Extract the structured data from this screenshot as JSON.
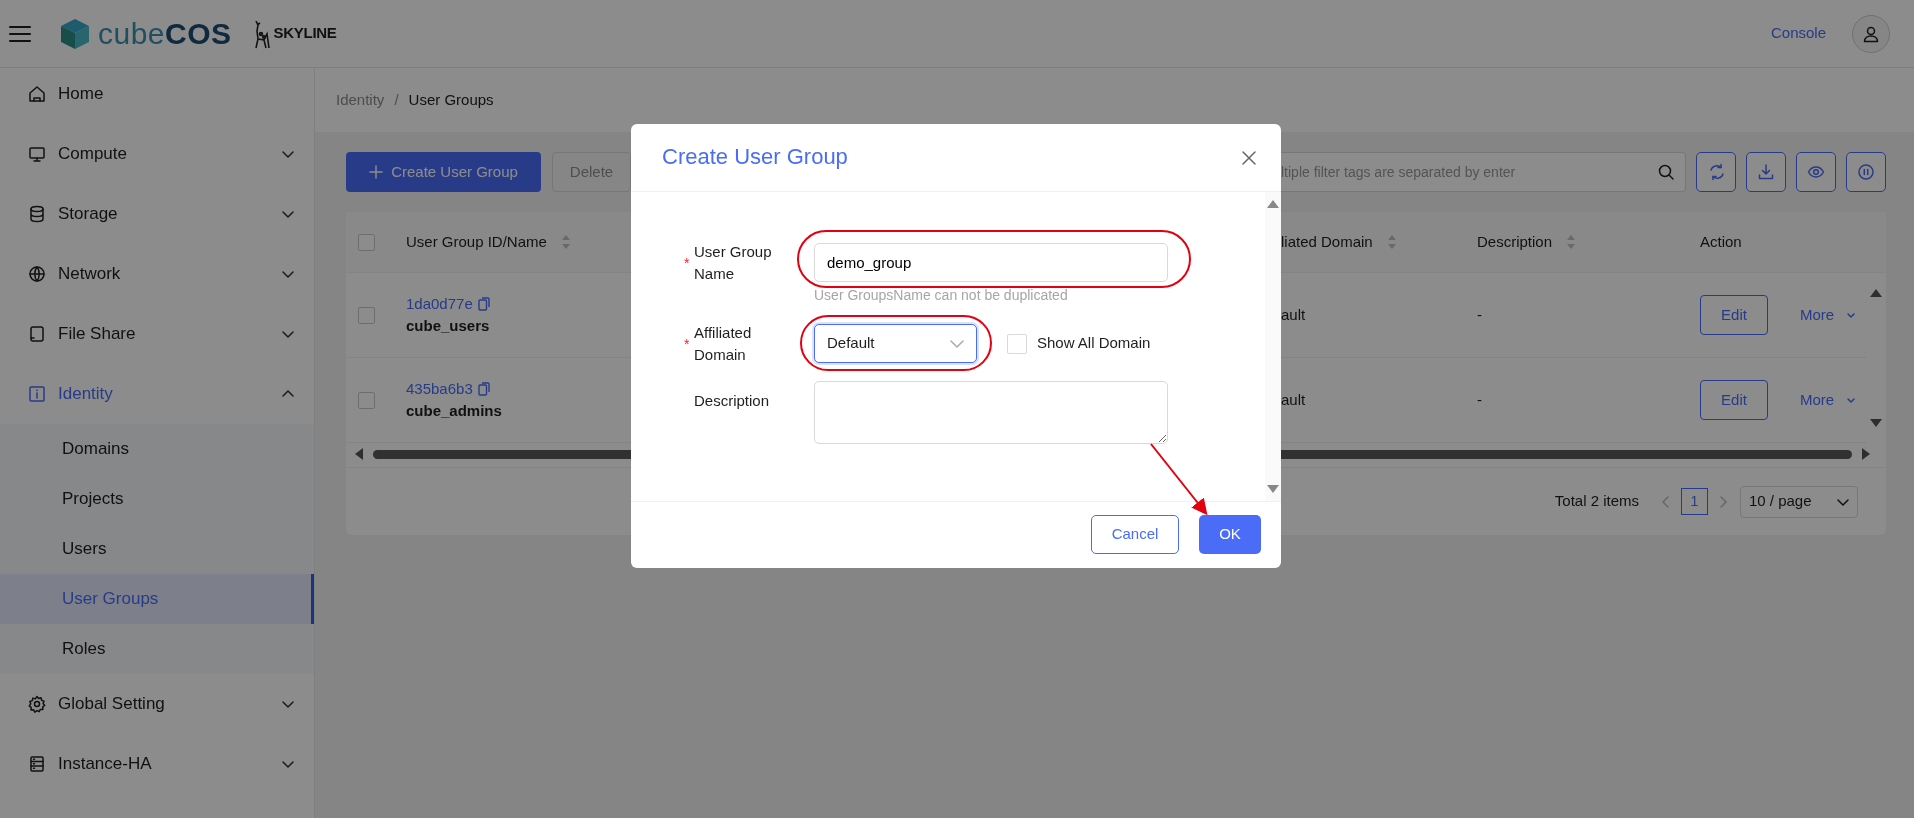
{
  "header": {
    "brand": "cube**COS**",
    "partner": "SKYLINE",
    "console_link": "Console"
  },
  "sidebar": {
    "items": [
      {
        "label": "Home"
      },
      {
        "label": "Compute",
        "expanded": false
      },
      {
        "label": "Storage",
        "expanded": false
      },
      {
        "label": "Network",
        "expanded": false
      },
      {
        "label": "File Share",
        "expanded": false
      },
      {
        "label": "Identity",
        "expanded": true,
        "selected": true,
        "children": [
          {
            "label": "Domains",
            "selected": false
          },
          {
            "label": "Projects",
            "selected": false
          },
          {
            "label": "Users",
            "selected": false
          },
          {
            "label": "User Groups",
            "selected": true
          },
          {
            "label": "Roles",
            "selected": false
          }
        ]
      },
      {
        "label": "Global Setting",
        "expanded": false
      },
      {
        "label": "Instance-HA",
        "expanded": false
      }
    ]
  },
  "breadcrumb": {
    "items": [
      "Identity",
      "User Groups"
    ],
    "separator": "/"
  },
  "toolbar": {
    "create_button": "Create User Group",
    "delete_button": "Delete",
    "delete_disabled": true,
    "search": {
      "placeholder": "ltiple filter tags are separated by enter"
    }
  },
  "table": {
    "all_checked": false,
    "columns": [
      {
        "label": "User Group ID/Name",
        "sortable": true
      },
      {
        "label": "liated Domain",
        "sortable": true
      },
      {
        "label": "Description",
        "sortable": true
      },
      {
        "label": "Action"
      }
    ],
    "rows": [
      {
        "checked": false,
        "id": "1da0d77e",
        "name": "cube_users",
        "domain": "ault",
        "description": "-",
        "edit": "Edit",
        "more": "More"
      },
      {
        "checked": false,
        "id": "435ba6b3",
        "name": "cube_admins",
        "domain": "ault",
        "description": "-",
        "edit": "Edit",
        "more": "More"
      }
    ]
  },
  "pagination": {
    "total": "Total 2 items",
    "pages": [
      {
        "label": "1",
        "selected": true
      }
    ],
    "page_size": "10 / page"
  },
  "dialog": {
    "title": "Create User Group",
    "required_mark": "*",
    "fields": [
      {
        "kind": "text",
        "label": "User Group Name",
        "required": true,
        "value": "demo_group",
        "help": "User GroupsName can not be duplicated",
        "highlighted": true
      },
      {
        "kind": "select",
        "label": "Affiliated Domain",
        "required": true,
        "value": "Default",
        "focused": true,
        "highlighted": true,
        "checkbox": {
          "label": "Show All Domain",
          "checked": false
        }
      },
      {
        "kind": "textarea",
        "label": "Description"
      }
    ],
    "buttons": [
      {
        "label": "Cancel",
        "kind": "secondary",
        "pointed": false
      },
      {
        "label": "OK",
        "kind": "primary",
        "pointed": true
      }
    ]
  }
}
